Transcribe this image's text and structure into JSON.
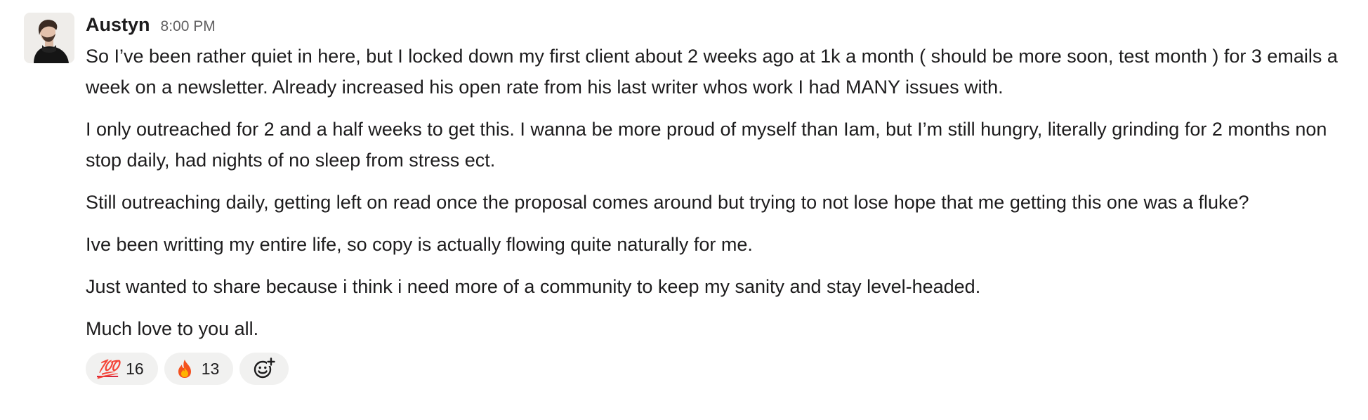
{
  "message": {
    "author": "Austyn",
    "timestamp": "8:00 PM",
    "paragraphs": [
      "So I’ve been rather quiet in here, but I locked down my first client about 2 weeks ago at 1k a month ( should be more soon, test month ) for 3 emails a week on a newsletter. Already increased his open rate from his last writer whos work I had MANY issues with.",
      "I only outreached for 2 and a half weeks to get this. I wanna be more proud of myself than Iam, but I’m still hungry, literally grinding for 2 months non stop daily, had nights of no sleep from stress ect.",
      "Still outreaching daily, getting left on read once the proposal comes around but trying to not lose hope that me getting this one was a fluke?",
      "Ive been writting my entire life, so copy is actually flowing quite naturally for me.",
      "Just wanted to share because i think i need more of a community to keep my sanity and stay level-headed.",
      "Much love to you all."
    ]
  },
  "reactions": [
    {
      "emoji": "hundred-points-emoji",
      "glyph": "💯",
      "count": "16"
    },
    {
      "emoji": "fire-emoji",
      "glyph": "🔥",
      "count": "13"
    }
  ],
  "icons": {
    "add_reaction": "add-reaction-icon"
  },
  "colors": {
    "text": "#1d1c1d",
    "muted": "#616061",
    "reaction_bg": "#f1f1f0"
  }
}
